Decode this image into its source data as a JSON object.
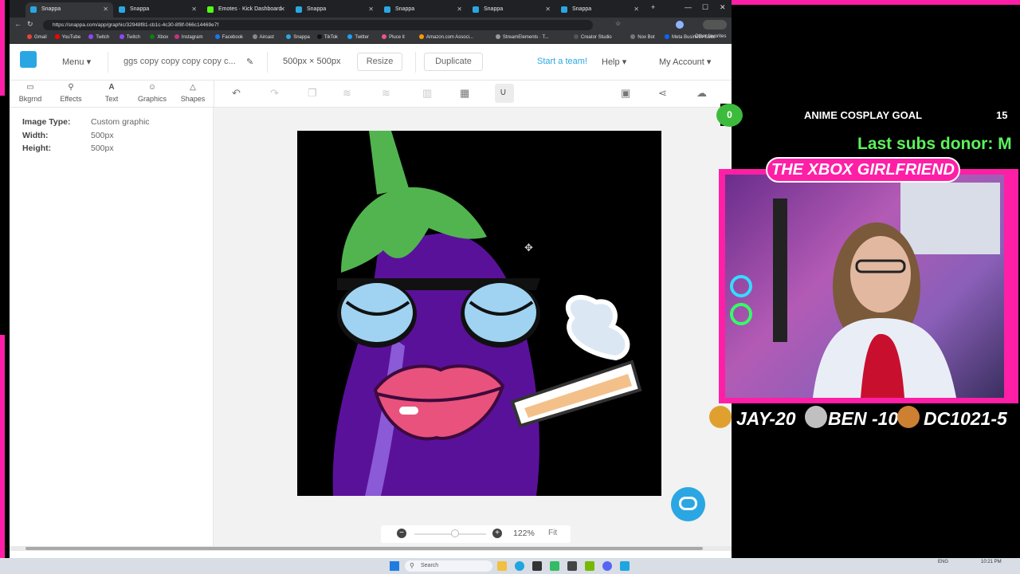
{
  "browser": {
    "tabs": [
      {
        "label": "Snappa"
      },
      {
        "label": "Snappa"
      },
      {
        "label": "Emotes · Kick Dashboard"
      },
      {
        "label": "Snappa"
      },
      {
        "label": "Snappa"
      },
      {
        "label": "Snappa"
      },
      {
        "label": "Snappa"
      }
    ],
    "new_tab": "+",
    "url": "https://snappa.com/app/graphic/32948f81-cb1c-4c30-8f8f-066c14469e7f",
    "bookmarks": [
      "Gmail",
      "YouTube",
      "Twitch",
      "Twitch",
      "Xbox",
      "Instagram",
      "Facebook",
      "Aircast",
      "Snappa",
      "TikTok",
      "Twitter",
      "Pluce it",
      "Amazon.com Associ...",
      "StreamElements · T...",
      "Creator Studio",
      "Nox Bot",
      "Meta Business Suite"
    ],
    "other_favorites": "Other favorites"
  },
  "header": {
    "menu": "Menu",
    "doc_title": "ggs copy copy copy copy c...",
    "dimensions": "500px × 500px",
    "resize": "Resize",
    "duplicate": "Duplicate",
    "start_team": "Start a team!",
    "help": "Help",
    "account": "My Account"
  },
  "tools": [
    {
      "icon": "image-icon",
      "label": "Bkgrnd"
    },
    {
      "icon": "wand-icon",
      "label": "Effects"
    },
    {
      "icon": "text-icon",
      "label": "Text"
    },
    {
      "icon": "smiley-icon",
      "label": "Graphics"
    },
    {
      "icon": "triangle-icon",
      "label": "Shapes"
    }
  ],
  "info": {
    "type_label": "Image Type:",
    "type_value": "Custom graphic",
    "width_label": "Width:",
    "width_value": "500px",
    "height_label": "Height:",
    "height_value": "500px"
  },
  "zoom": {
    "level": "122%",
    "fit": "Fit"
  },
  "taskbar": {
    "search": "Search",
    "lang": "ENG",
    "time": "10:21 PM"
  },
  "overlay": {
    "goal_count_left": "0",
    "goal_label": "ANIME COSPLAY GOAL",
    "goal_count_right": "15",
    "ticker": "Last subs donor: M",
    "cam_title": "THE XBOX GIRLFRIEND",
    "leaderboard": [
      "JAY-20",
      "BEN -10",
      "DC1021-5"
    ]
  },
  "colors": {
    "accent": "#2aa7e2",
    "stream_pink": "#ff1fa6",
    "ticker_green": "#5cf25c",
    "eggplant": "#5a119a",
    "leaf": "#52b44e"
  }
}
